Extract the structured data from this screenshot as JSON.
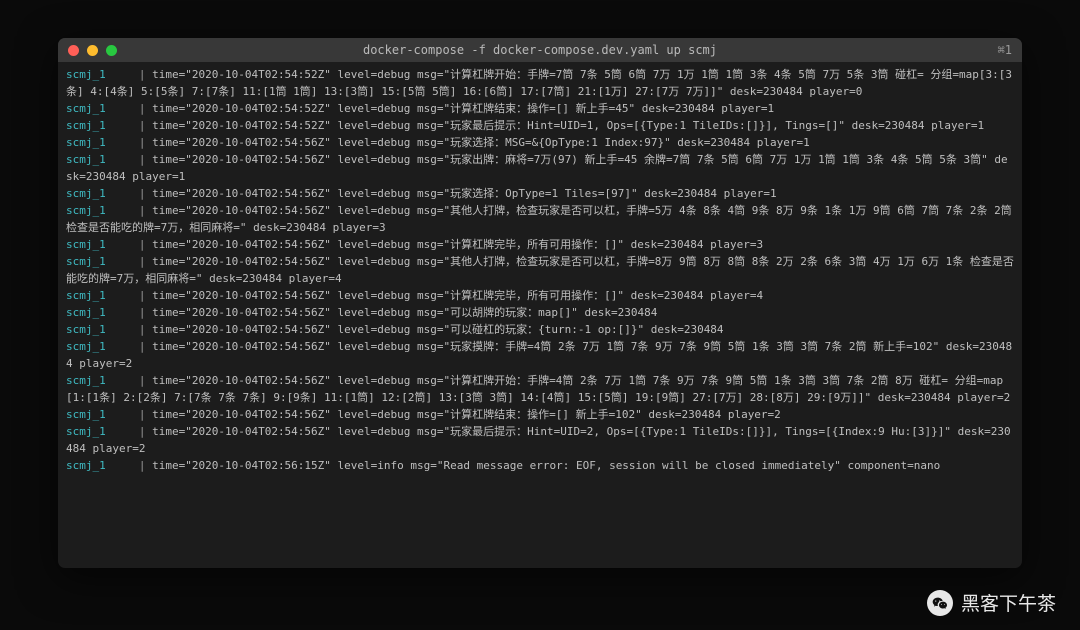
{
  "window": {
    "title": "docker-compose -f docker-compose.dev.yaml up scmj",
    "shortcut": "⌘1"
  },
  "colors": {
    "prefix": "#3fbac2",
    "text": "#bfbfbf",
    "bg": "#1c1c1c"
  },
  "log_prefix": "scmj_1",
  "pipe": " | ",
  "logs": [
    "time=\"2020-10-04T02:54:52Z\" level=debug msg=\"计算杠牌开始：手牌=7筒 7条 5筒 6筒 7万 1万 1筒 1筒 3条 4条 5筒 7万 5条 3筒 碰杠= 分组=map[3:[3条] 4:[4条] 5:[5条] 7:[7条] 11:[1筒 1筒] 13:[3筒] 15:[5筒 5筒] 16:[6筒] 17:[7筒] 21:[1万] 27:[7万 7万]]\" desk=230484 player=0",
    "time=\"2020-10-04T02:54:52Z\" level=debug msg=\"计算杠牌结束：操作=[] 新上手=45\" desk=230484 player=1",
    "time=\"2020-10-04T02:54:52Z\" level=debug msg=\"玩家最后提示：Hint=UID=1, Ops=[{Type:1 TileIDs:[]}], Tings=[]\" desk=230484 player=1",
    "time=\"2020-10-04T02:54:56Z\" level=debug msg=\"玩家选择：MSG=&{OpType:1 Index:97}\" desk=230484 player=1",
    "time=\"2020-10-04T02:54:56Z\" level=debug msg=\"玩家出牌：麻将=7万(97) 新上手=45 余牌=7筒 7条 5筒 6筒 7万 1万 1筒 1筒 3条 4条 5筒 5条 3筒\" desk=230484 player=1",
    "time=\"2020-10-04T02:54:56Z\" level=debug msg=\"玩家选择：OpType=1 Tiles=[97]\" desk=230484 player=1",
    "time=\"2020-10-04T02:54:56Z\" level=debug msg=\"其他人打牌，检查玩家是否可以杠，手牌=5万 4条 8条 4筒 9条 8万 9条 1条 1万 9筒 6筒 7筒 7条 2条 2筒 检查是否能吃的牌=7万，相同麻将=\" desk=230484 player=3",
    "time=\"2020-10-04T02:54:56Z\" level=debug msg=\"计算杠牌完毕，所有可用操作：[]\" desk=230484 player=3",
    "time=\"2020-10-04T02:54:56Z\" level=debug msg=\"其他人打牌，检查玩家是否可以杠，手牌=8万 9筒 8万 8筒 8条 2万 2条 6条 3筒 4万 1万 6万 1条 检查是否能吃的牌=7万，相同麻将=\" desk=230484 player=4",
    "time=\"2020-10-04T02:54:56Z\" level=debug msg=\"计算杠牌完毕，所有可用操作：[]\" desk=230484 player=4",
    "time=\"2020-10-04T02:54:56Z\" level=debug msg=\"可以胡牌的玩家：map[]\" desk=230484",
    "time=\"2020-10-04T02:54:56Z\" level=debug msg=\"可以碰杠的玩家：{turn:-1 op:[]}\" desk=230484",
    "time=\"2020-10-04T02:54:56Z\" level=debug msg=\"玩家摸牌：手牌=4筒 2条 7万 1筒 7条 9万 7条 9筒 5筒 1条 3筒 3筒 7条 2筒 新上手=102\" desk=230484 player=2",
    "time=\"2020-10-04T02:54:56Z\" level=debug msg=\"计算杠牌开始：手牌=4筒 2条 7万 1筒 7条 9万 7条 9筒 5筒 1条 3筒 3筒 7条 2筒 8万 碰杠= 分组=map[1:[1条] 2:[2条] 7:[7条 7条 7条] 9:[9条] 11:[1筒] 12:[2筒] 13:[3筒 3筒] 14:[4筒] 15:[5筒] 19:[9筒] 27:[7万] 28:[8万] 29:[9万]]\" desk=230484 player=2",
    "time=\"2020-10-04T02:54:56Z\" level=debug msg=\"计算杠牌结束：操作=[] 新上手=102\" desk=230484 player=2",
    "time=\"2020-10-04T02:54:56Z\" level=debug msg=\"玩家最后提示：Hint=UID=2, Ops=[{Type:1 TileIDs:[]}], Tings=[{Index:9 Hu:[3]}]\" desk=230484 player=2",
    "time=\"2020-10-04T02:56:15Z\" level=info msg=\"Read message error: EOF, session will be closed immediately\" component=nano"
  ],
  "watermark": {
    "text": "黑客下午茶",
    "icon": "wechat"
  }
}
